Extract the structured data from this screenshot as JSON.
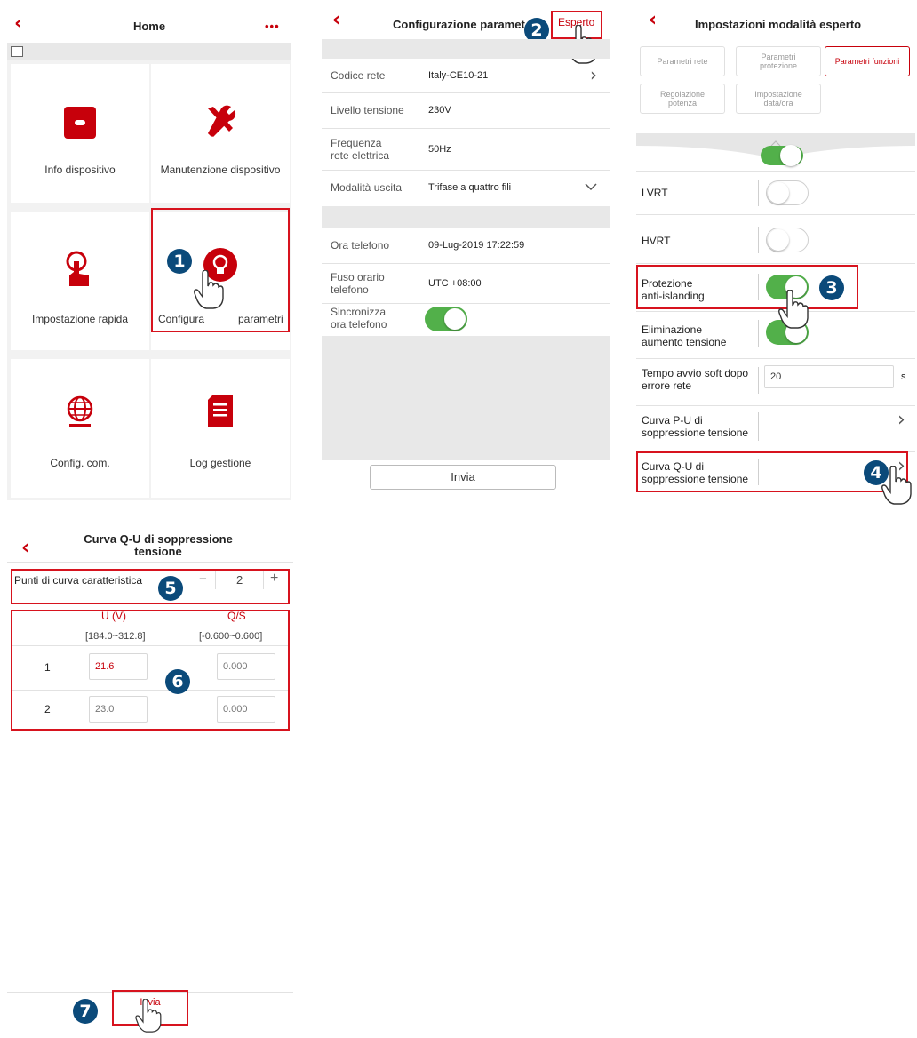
{
  "screen1": {
    "title": "Home",
    "back_icon": "‹",
    "more_icon": "•••",
    "tiles": [
      {
        "label": "Info dispositivo",
        "icon": "device-info-icon"
      },
      {
        "label": "Manutenzione dispositivo",
        "icon": "tools-icon"
      },
      {
        "label": "Impostazione rapida",
        "icon": "touch-icon"
      },
      {
        "label": "Configura",
        "label_end": "parametri",
        "icon": "bulb-gear-icon"
      },
      {
        "label": "Config. com.",
        "icon": "globe-icon"
      },
      {
        "label": "Log gestione",
        "icon": "document-icon"
      }
    ]
  },
  "screen2": {
    "title": "Configurazione paramet",
    "expert_label": "Esperto",
    "rows": [
      {
        "label": "Codice rete",
        "value": "Italy-CE10-21"
      },
      {
        "label": "Livello tensione",
        "value": "230V"
      },
      {
        "label": "Frequenza\nrete elettrica",
        "value": "50Hz"
      },
      {
        "label": "Modalità uscita",
        "value": "Trifase a quattro fili"
      }
    ],
    "rows2": [
      {
        "label": "Ora telefono",
        "value": "09-Lug-2019 17:22:59"
      },
      {
        "label": "Fuso orario\ntelefono",
        "value": "UTC +08:00"
      },
      {
        "label": "Sincronizza\nora telefono",
        "value": ""
      }
    ],
    "sync_toggle_on": true,
    "submit_label": "Invia"
  },
  "screen3": {
    "title": "Impostazioni modalità esperto",
    "tabs": [
      {
        "label": "Parametri rete",
        "active": false
      },
      {
        "label": "Parametri\nprotezione",
        "active": false
      },
      {
        "label": "Parametri funzioni",
        "active": true
      },
      {
        "label": "Regolazione\npotenza",
        "active": false
      },
      {
        "label": "Impostazione\ndata/ora",
        "active": false
      }
    ],
    "rows": [
      {
        "label": "LVRT",
        "toggle": false
      },
      {
        "label": "HVRT",
        "toggle": false
      },
      {
        "label": "Protezione\nanti-islanding",
        "toggle": true
      },
      {
        "label": "Eliminazione\naumento tensione",
        "toggle": true
      }
    ],
    "soft_start": {
      "label": "Tempo avvio soft dopo\nerrore rete",
      "value": "20",
      "unit": "s"
    },
    "pu_curve": "Curva P-U di\nsoppressione tensione",
    "qu_curve": "Curva Q-U di\nsoppressione tensione"
  },
  "screen4": {
    "title": "Curva Q-U di soppressione\ntensione",
    "points_label": "Punti di curva caratteristica",
    "points_value": "2",
    "minus": "−",
    "plus": "+",
    "col_u": "U (V)",
    "col_q": "Q/S",
    "range_u": "[184.0~312.8]",
    "range_q": "[-0.600~0.600]",
    "table": [
      {
        "index": "1",
        "u": "21.6",
        "q": "0.000"
      },
      {
        "index": "2",
        "u": "23.0",
        "q": "0.000"
      }
    ],
    "submit_label": "Invia"
  },
  "steps": [
    "1",
    "2",
    "3",
    "4",
    "5",
    "6",
    "7"
  ],
  "colors": {
    "accent": "#c7000b",
    "toggle_on": "#52b04a",
    "badge": "#0b4a7a",
    "highlight": "#d7131e"
  }
}
